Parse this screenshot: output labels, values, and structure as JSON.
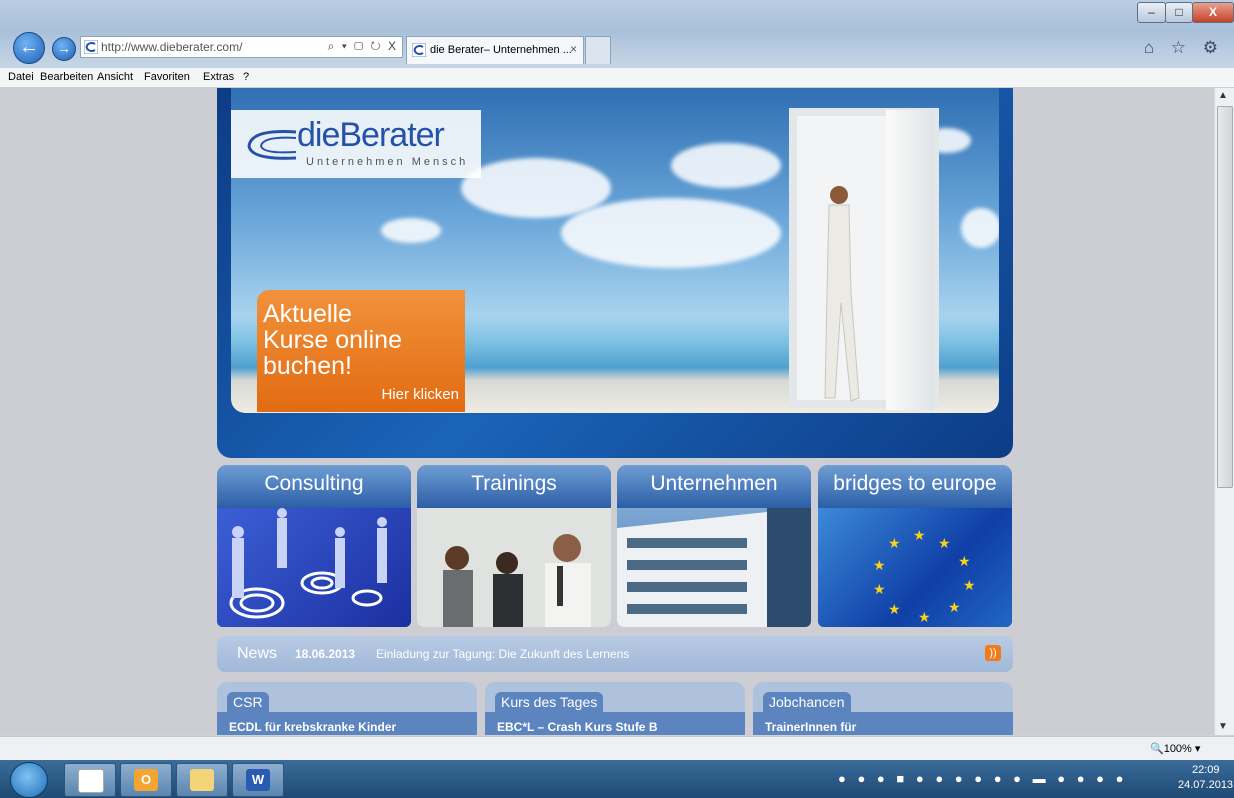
{
  "browser": {
    "window_buttons": {
      "minimize": "–",
      "maximize": "□",
      "close": "X"
    },
    "back_arrow": "←",
    "forward_arrow": "→",
    "address": {
      "url": "http://www.dieberater.com/",
      "tools": "⌕ ▾ ▢ ↻ X"
    },
    "tab": {
      "title": "die Berater– Unternehmen ...",
      "close": "×"
    },
    "tool_icons": "⌂ ☆ ⚙",
    "menu": [
      "Datei",
      "Bearbeiten",
      "Ansicht",
      "Favoriten",
      "Extras",
      "?"
    ],
    "status": {
      "zoom": "🔍100%  ▾"
    },
    "scroll": {
      "up": "▲",
      "down": "▼"
    }
  },
  "page": {
    "logo": {
      "name": "dieBerater",
      "registered": "®",
      "tagline": "Unternehmen Mensch"
    },
    "promo": {
      "line1": "Aktuelle",
      "line2": "Kurse online",
      "line3": "buchen!",
      "link": "Hier klicken"
    },
    "tiles": [
      {
        "label": "Consulting"
      },
      {
        "label": "Trainings"
      },
      {
        "label": "Unternehmen"
      },
      {
        "label": "bridges to europe"
      }
    ],
    "news": {
      "label": "News",
      "date": "18.06.2013",
      "text": "Einladung zur Tagung: Die Zukunft des Lernens",
      "rss_symbol": "))"
    },
    "boxes": [
      {
        "title": "CSR",
        "text": "ECDL für krebskranke Kinder"
      },
      {
        "title": "Kurs des Tages",
        "text": "EBC*L – Crash Kurs Stufe B"
      },
      {
        "title": "Jobchancen",
        "text": "TrainerInnen für"
      }
    ]
  },
  "taskbar": {
    "apps": [
      "app-icon",
      "outlook-icon",
      "explorer-icon",
      "word-icon"
    ],
    "word_letter": "W",
    "outlook_letter": "O",
    "tray_icons": "● ● ● ■ ● ● ● ● ● ● ▬ ● ● ● ●",
    "time": "22:09",
    "date": "24.07.2013"
  },
  "colors": {
    "brand_blue": "#2552a8",
    "promo_orange": "#e26b12",
    "tile_head": "#2c5ea7",
    "news_bar": "#a1b8d9"
  }
}
